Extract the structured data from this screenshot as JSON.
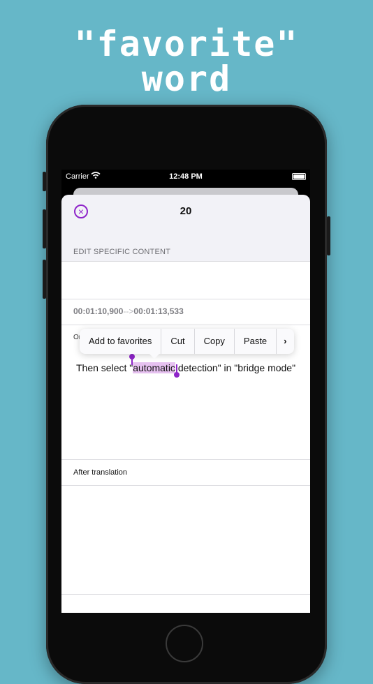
{
  "promo": {
    "line1": "\"favorite\"",
    "line2": "word"
  },
  "status_bar": {
    "carrier": "Carrier",
    "time": "12:48 PM"
  },
  "sheet": {
    "title": "20",
    "section_header": "EDIT SPECIFIC CONTENT",
    "timecode_start": "00:01:10,900",
    "timecode_arrow": "-->",
    "timecode_end": "00:01:13,533",
    "original_label": "Or",
    "text_before": "Then select \"",
    "text_selected": "automatic",
    "text_after": " detection\" in \"bridge mode\"",
    "after_translation_label": "After translation"
  },
  "context_menu": {
    "items": [
      "Add to favorites",
      "Cut",
      "Copy",
      "Paste"
    ],
    "more": "›"
  },
  "colors": {
    "accent": "#8e24c9",
    "background": "#66b7c8",
    "selection": "#e6c1f0"
  }
}
